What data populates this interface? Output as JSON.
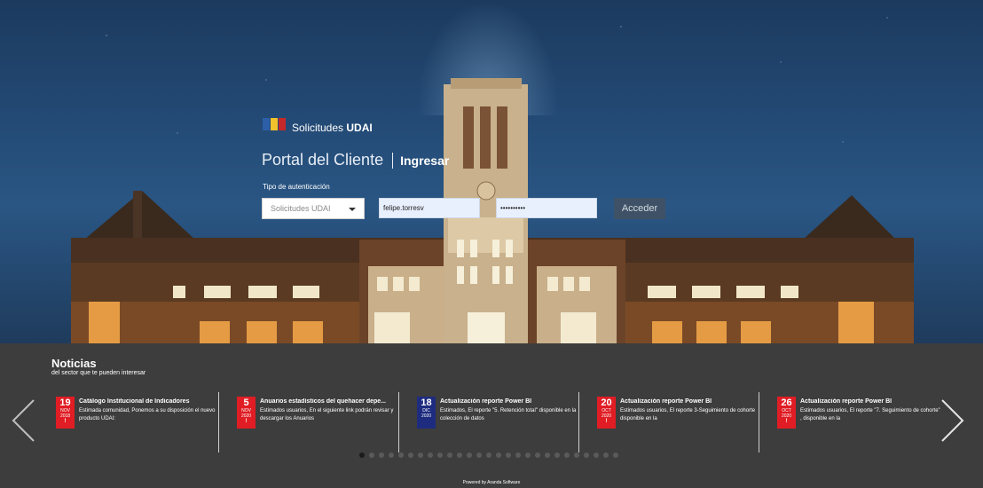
{
  "login": {
    "brand_prefix": "Solicitudes",
    "brand_name": "UDAI",
    "portal_title": "Portal del Cliente",
    "portal_action": "Ingresar",
    "auth_label": "Tipo de autenticación",
    "auth_selected": "Solicitudes UDAI",
    "username_value": "felipe.torresv",
    "password_value": "••••••••••",
    "submit_label": "Acceder"
  },
  "news": {
    "title": "Noticias",
    "subtitle": "del sector que te pueden interesar",
    "items": [
      {
        "day": "19",
        "month": "NOV",
        "year": "2018",
        "flag": "!",
        "color": "#e01d24",
        "title": "Catálogo Institucional de Indicadores",
        "desc": "Estimada comunidad, Ponemos a su disposición el nuevo producto UDAI:"
      },
      {
        "day": "5",
        "month": "NOV",
        "year": "2020",
        "flag": "!",
        "color": "#e01d24",
        "title": "Anuarios estadísticos del quehacer depe...",
        "desc": "Estimados usuarios, En el siguiente link podrán revisar y descargar los Anuarios"
      },
      {
        "day": "18",
        "month": "DIC",
        "year": "2020",
        "flag": "",
        "color": "#1e2c7f",
        "title": "Actualización reporte Power BI",
        "desc": "Estimados, El reporte \"5. Retención total\" disponible en la colección de datos"
      },
      {
        "day": "20",
        "month": "OCT",
        "year": "2020",
        "flag": "!",
        "color": "#e01d24",
        "title": "Actualización reporte Power BI",
        "desc": "Estimados usuarios, El reporte 3-Seguimiento de cohorte disponible en la"
      },
      {
        "day": "26",
        "month": "OCT",
        "year": "2020",
        "flag": "!",
        "color": "#e01d24",
        "title": "Actualización reporte Power BI",
        "desc": "Estimados usuarios, El reporte \"7. Seguimiento de cohorte\" , disponible en la"
      }
    ],
    "page_count": 27,
    "active_page": 1
  },
  "footer": {
    "powered_by": "Powered by Aranda Software"
  },
  "colors": {
    "news_background": "#3d3d3d",
    "badge_red": "#e01d24",
    "badge_navy": "#1e2c7f"
  },
  "icons": {
    "brand": "university-shield-logo-icon",
    "select_caret": "caret-down-icon",
    "prev": "chevron-left-icon",
    "next": "chevron-right-icon"
  }
}
